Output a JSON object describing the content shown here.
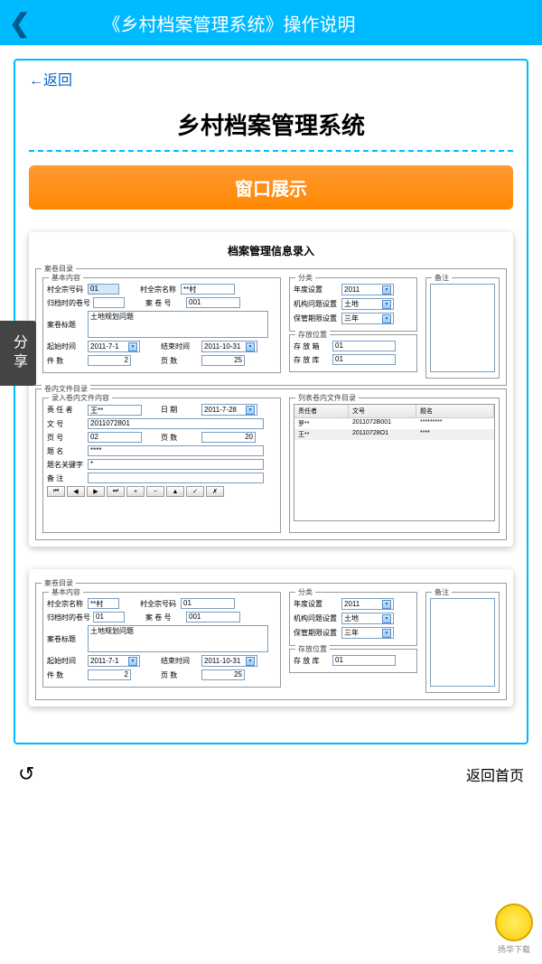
{
  "header": {
    "title": "《乡村档案管理系统》操作说明"
  },
  "nav": {
    "back_link": "←返回",
    "page_title": "乡村档案管理系统",
    "section_banner": "窗口展示"
  },
  "screenshot1": {
    "title": "档案管理信息录入",
    "group_main": "案卷目录",
    "group_basic": "基本内容",
    "basic": {
      "code_label": "村全宗号码",
      "code_value": "01",
      "name_label": "村全宗名称",
      "name_value": "**村",
      "archive_num_label": "归档时的卷号",
      "archive_num_value": "",
      "volume_label": "案 卷 号",
      "volume_value": "001",
      "title_label": "案卷标题",
      "title_value": "土地规划问题",
      "start_label": "起始时间",
      "start_value": "2011-7-1",
      "end_label": "结束时间",
      "end_value": "2011-10-31",
      "count_label": "件  数",
      "count_value": "2",
      "pages_label": "页  数",
      "pages_value": "25"
    },
    "group_category": "分类",
    "category": {
      "year_label": "年度设置",
      "year_value": "2011",
      "org_label": "机构问题设置",
      "org_value": "土地",
      "retain_label": "保管期限设置",
      "retain_value": "三年"
    },
    "group_remark": "备注",
    "group_storage": "存放位置",
    "storage": {
      "box_label": "存 放 箱",
      "box_value": "01",
      "store_label": "存 放 库",
      "store_value": "01"
    },
    "group_volume_files": "卷内文件目录",
    "group_entry": "录入卷内文件内容",
    "entry": {
      "responsible_label": "责 任 者",
      "responsible_value": "王**",
      "date_label": "日  期",
      "date_value": "2011-7-28",
      "docnum_label": "文  号",
      "docnum_value": "2011072801",
      "pagenum_label": "页  号",
      "pagenum_value": "02",
      "pagecount_label": "页  数",
      "pagecount_value": "20",
      "title_label": "题  名",
      "title_value": "****",
      "keyword_label": "题名关键字",
      "keyword_value": "*",
      "remark_label": "备  注"
    },
    "group_list": "列表卷内文件目录",
    "list": {
      "col1": "责任者",
      "col2": "文号",
      "col3": "题名",
      "rows": [
        {
          "c1": "罗**",
          "c2": "2011072B001",
          "c3": "*********"
        },
        {
          "c1": "王**",
          "c2": "20110728O1",
          "c3": "****"
        }
      ]
    }
  },
  "bottom": {
    "home_text": "返回首页"
  },
  "share_label": "分享",
  "watermark": "扬华下载"
}
